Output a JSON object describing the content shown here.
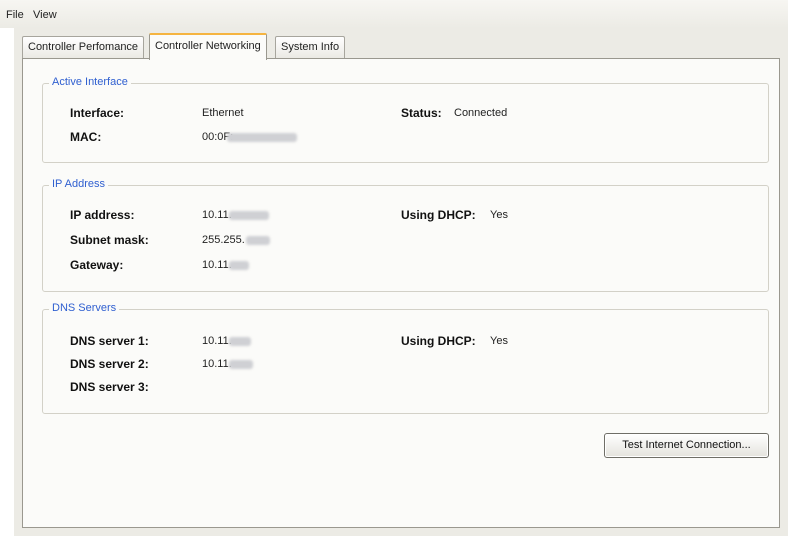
{
  "menu": {
    "file": "File",
    "view": "View"
  },
  "tabs": [
    {
      "label": "Controller Perfomance"
    },
    {
      "label": "Controller Networking"
    },
    {
      "label": "System Info"
    }
  ],
  "active_interface": {
    "legend": "Active Interface",
    "interface_label": "Interface:",
    "interface_value": "Ethernet",
    "status_label": "Status:",
    "status_value": "Connected",
    "mac_label": "MAC:",
    "mac_value": "00:0F:"
  },
  "ip_address": {
    "legend": "IP Address",
    "ip_label": "IP address:",
    "ip_value": "10.11.",
    "subnet_label": "Subnet mask:",
    "subnet_value": "255.255.",
    "gateway_label": "Gateway:",
    "gateway_value": "10.11.",
    "dhcp_label": "Using DHCP:",
    "dhcp_value": "Yes"
  },
  "dns_servers": {
    "legend": "DNS Servers",
    "dns1_label": "DNS server 1:",
    "dns1_value": "10.11.",
    "dns2_label": "DNS server 2:",
    "dns2_value": "10.11.",
    "dns3_label": "DNS server 3:",
    "dhcp_label": "Using DHCP:",
    "dhcp_value": "Yes"
  },
  "buttons": {
    "test_connection": "Test Internet Connection..."
  },
  "colors": {
    "legend": "#2f5fd0",
    "active_tab_accent": "#f5b440",
    "panel": "#fbfbf9",
    "window": "#ecebe5"
  }
}
